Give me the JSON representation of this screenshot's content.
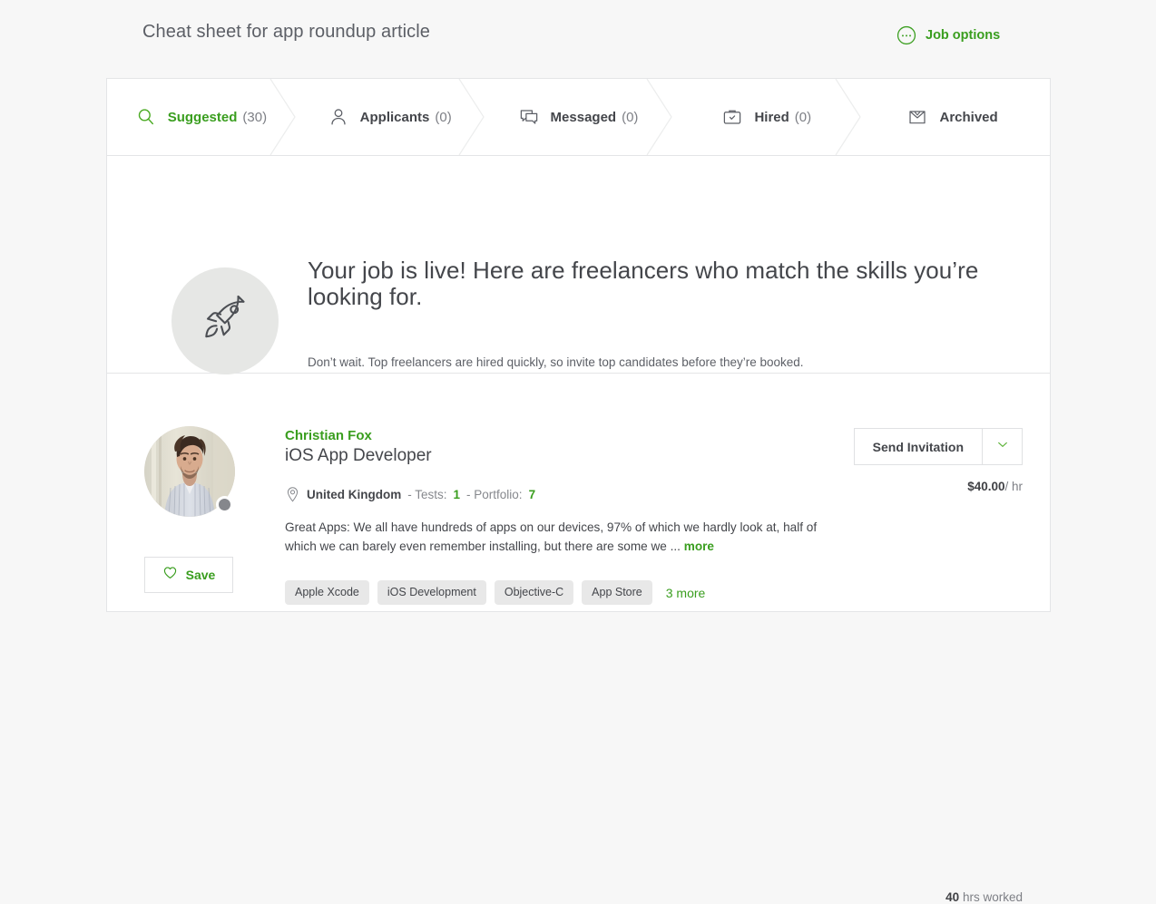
{
  "header": {
    "title": "Cheat sheet for app roundup article",
    "job_options_label": "Job options",
    "job_options_icon": "ellipsis-circle-icon"
  },
  "colors": {
    "accent_green": "#3a9e1f",
    "page_background": "#f7f7f7",
    "card_background": "#ffffff",
    "border": "#e4e5e7",
    "text_primary": "#44464b",
    "text_muted": "#7d7f85",
    "tag_background": "#e8e8e8",
    "status_dot": "#85878c"
  },
  "tabs": [
    {
      "label": "Suggested",
      "count": "(30)",
      "icon": "search-icon",
      "active": true
    },
    {
      "label": "Applicants",
      "count": "(0)",
      "icon": "person-icon",
      "active": false
    },
    {
      "label": "Messaged",
      "count": "(0)",
      "icon": "chat-bubble-icon",
      "active": false
    },
    {
      "label": "Hired",
      "count": "(0)",
      "icon": "briefcase-check-icon",
      "active": false
    },
    {
      "label": "Archived",
      "count": "",
      "icon": "archive-inbox-icon",
      "active": false
    }
  ],
  "hero": {
    "icon": "rocket-icon",
    "title": "Your job is live! Here are freelancers who match the skills you’re looking for.",
    "subtitle": "Don’t wait. Top freelancers are hired quickly, so invite top candidates before they’re booked."
  },
  "freelancer": {
    "avatar_alt": "profile-photo",
    "status": "offline",
    "save_label": "Save",
    "save_icon": "heart-icon",
    "name": "Christian Fox",
    "title": "iOS App Developer",
    "location_icon": "location-pin-icon",
    "country": "United Kingdom",
    "tests_label": "- Tests:",
    "tests_value": "1",
    "portfolio_label": "- Portfolio:",
    "portfolio_value": "7",
    "description": "Great Apps: We all have hundreds of apps on our devices, 97% of which we hardly look at, half of which we can barely even remember installing, but there are some we ...",
    "description_more": "more",
    "skills": [
      "Apple Xcode",
      "iOS Development",
      "Objective-C",
      "App Store"
    ],
    "skills_more": "3 more",
    "invite_label": "Send Invitation",
    "invite_caret_icon": "chevron-down-icon",
    "rate_amount": "$40.00",
    "rate_unit": "/ hr",
    "hours_value": "40",
    "hours_label": "hrs worked"
  }
}
